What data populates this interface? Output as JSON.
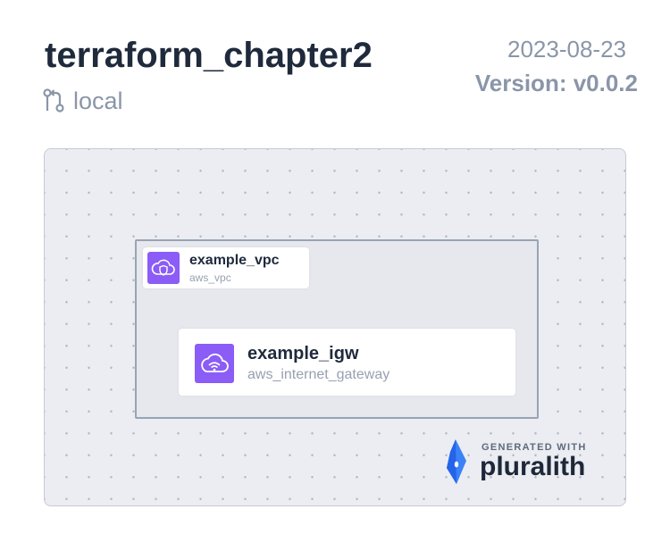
{
  "header": {
    "title": "terraform_chapter2",
    "branch": "local",
    "date": "2023-08-23",
    "version": "Version: v0.0.2"
  },
  "diagram": {
    "nodes": [
      {
        "name": "example_vpc",
        "type": "aws_vpc",
        "icon": "vpc-cloud-shield-icon"
      },
      {
        "name": "example_igw",
        "type": "aws_internet_gateway",
        "icon": "internet-gateway-cloud-wifi-icon"
      }
    ],
    "containment": [
      {
        "parent": "example_vpc",
        "child": "example_igw"
      }
    ]
  },
  "footer": {
    "generated_with": "GENERATED WITH",
    "brand": "pluralith",
    "logo_icon": "pluralith-logo-icon"
  },
  "colors": {
    "icon_bg": "#8b5cf6",
    "title": "#1f2a3c",
    "muted": "#8a96a8",
    "logo": "#3b82f6"
  }
}
